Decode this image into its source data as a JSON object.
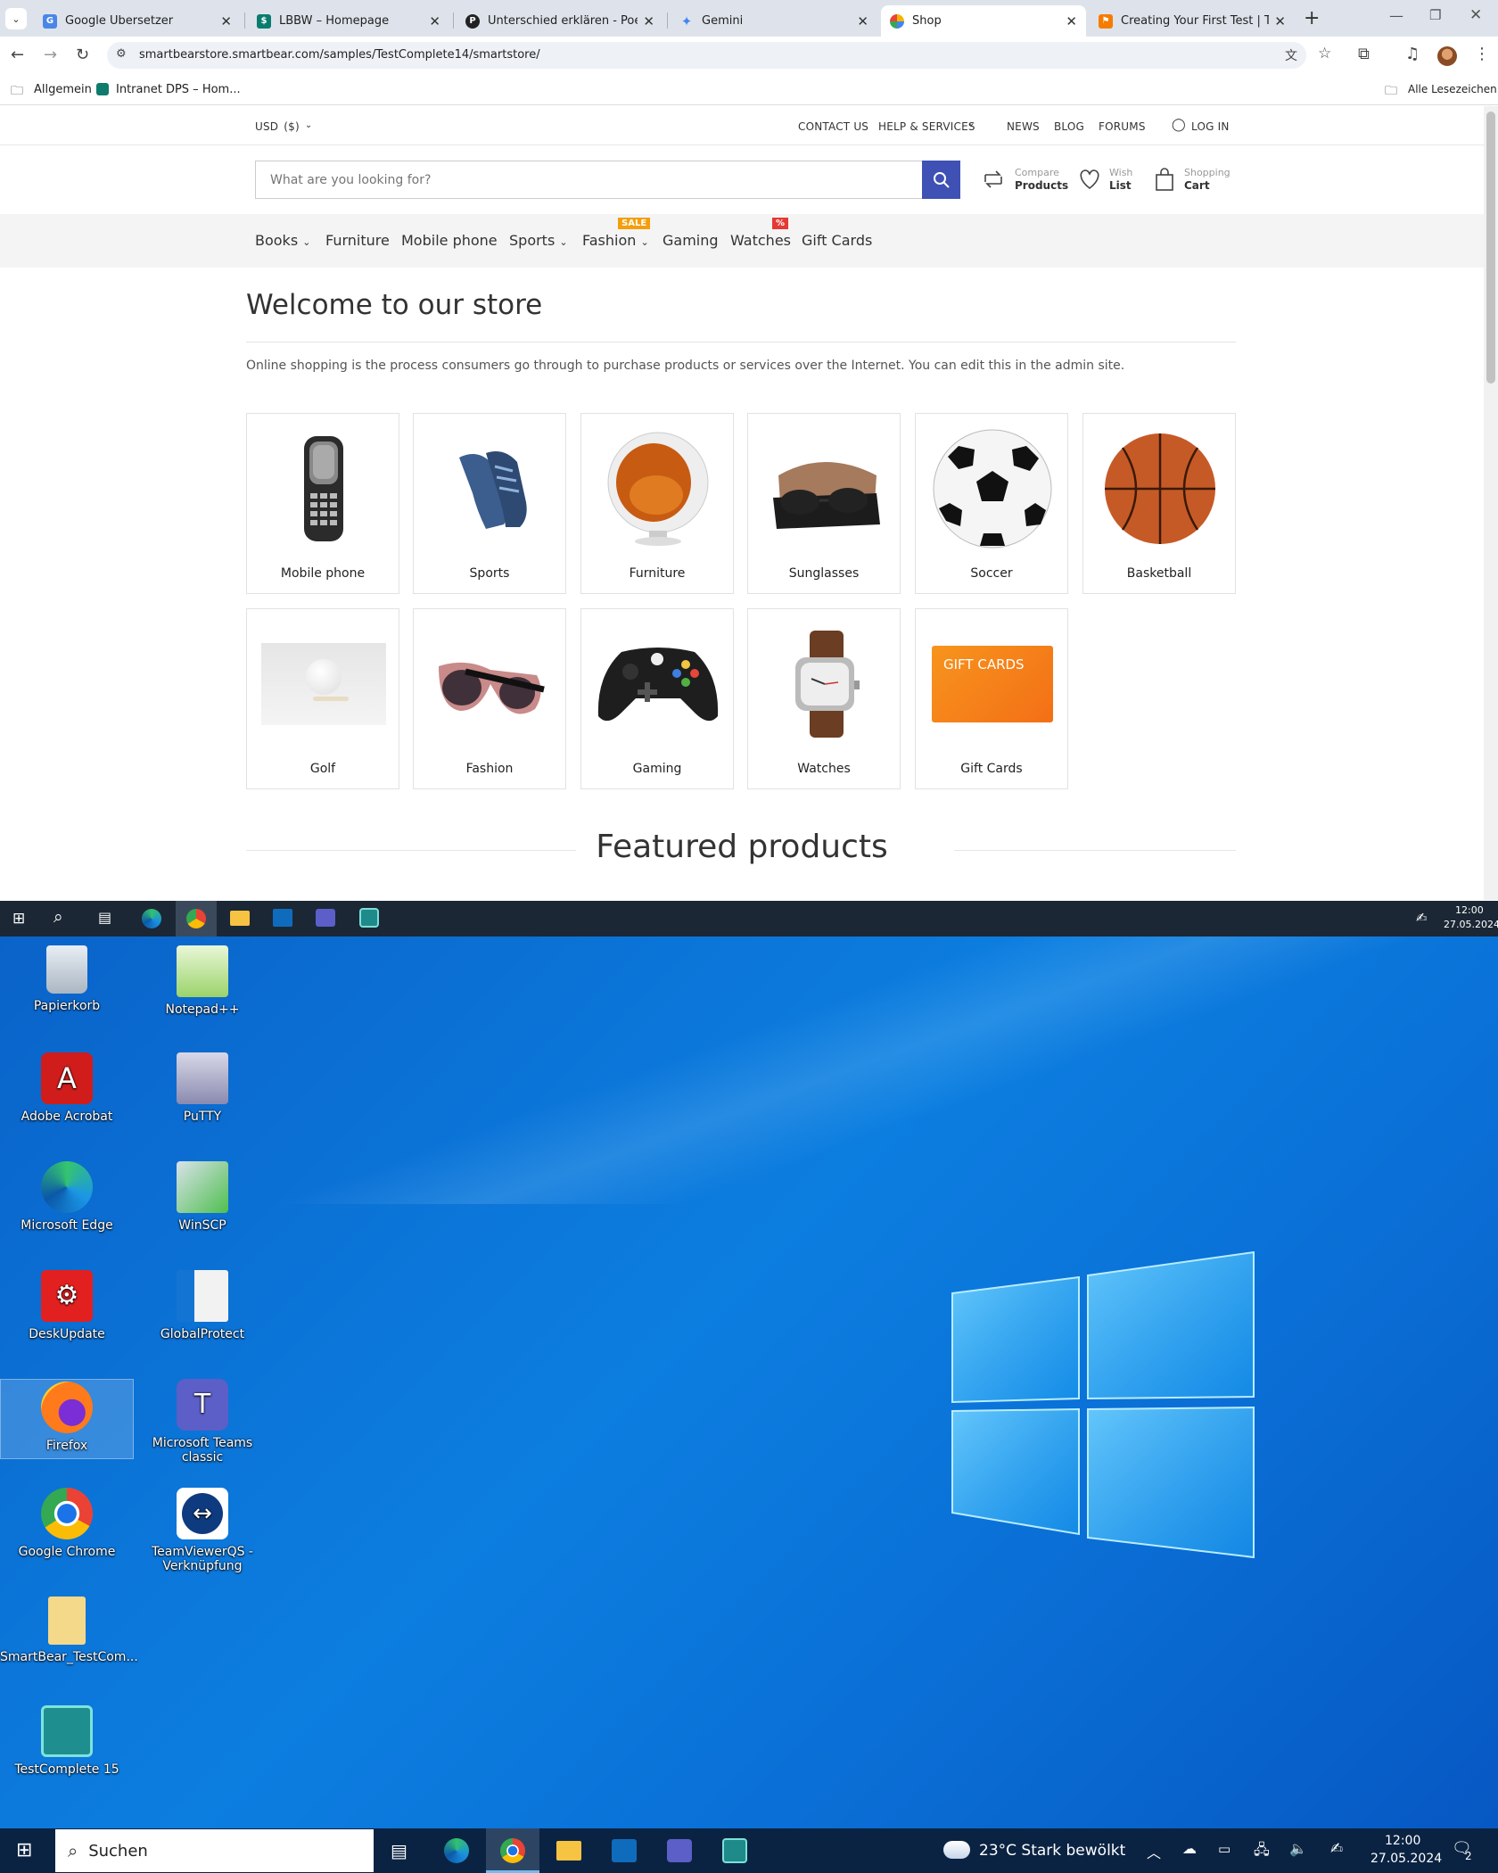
{
  "browser": {
    "tabs": [
      {
        "title": "Google Übersetzer",
        "active": false
      },
      {
        "title": "LBBW – Homepage",
        "active": false
      },
      {
        "title": "Unterschied erklären - Poe",
        "active": false
      },
      {
        "title": "Gemini",
        "active": false
      },
      {
        "title": "Shop",
        "active": true
      },
      {
        "title": "Creating Your First Test | TestCo",
        "active": false
      }
    ],
    "new_tab": "+",
    "url": "smartbearstore.smartbear.com/samples/TestComplete14/smartstore/",
    "bookmarks": [
      "Allgemein",
      "Intranet DPS – Hom..."
    ],
    "all_bookmarks": "Alle Lesezeichen"
  },
  "store": {
    "currency": "USD",
    "currency_symbol": "($)",
    "top_links": [
      "CONTACT US",
      "HELP & SERVICES",
      "NEWS",
      "BLOG",
      "FORUMS"
    ],
    "login": "LOG IN",
    "search_placeholder": "What are you looking for?",
    "compare": {
      "line1": "Compare",
      "line2": "Products"
    },
    "wishlist": {
      "line1": "Wish",
      "line2": "List"
    },
    "cart": {
      "line1": "Shopping",
      "line2": "Cart"
    },
    "nav": [
      "Books",
      "Furniture",
      "Mobile phone",
      "Sports",
      "Fashion",
      "Gaming",
      "Watches",
      "Gift Cards"
    ],
    "badge_sale": "SALE",
    "badge_percent": "%",
    "welcome_title": "Welcome to our store",
    "welcome_text": "Online shopping is the process consumers go through to purchase products or services over the Internet. You can edit this in the admin site.",
    "categories": [
      "Mobile phone",
      "Sports",
      "Furniture",
      "Sunglasses",
      "Soccer",
      "Basketball",
      "Golf",
      "Fashion",
      "Gaming",
      "Watches",
      "Gift Cards"
    ],
    "giftcard_text": "GIFT CARDS",
    "featured_title": "Featured products"
  },
  "taskbar_small": {
    "time": "12:00",
    "date": "27.05.2024"
  },
  "desktop_icons": [
    "Papierkorb",
    "Notepad++",
    "Adobe Acrobat",
    "PuTTY",
    "Microsoft Edge",
    "WinSCP",
    "DeskUpdate",
    "GlobalProtect",
    "Firefox",
    "Microsoft Teams classic",
    "Google Chrome",
    "TeamViewerQS - Verknüpfung",
    "SmartBear_TestCom...",
    "TestComplete 15"
  ],
  "taskbar": {
    "search_placeholder": "Suchen",
    "weather": "23°C  Stark bewölkt",
    "time": "12:00",
    "date": "27.05.2024",
    "notification_count": "2"
  },
  "colors": {
    "accent": "#3f51b5",
    "sale_badge": "#f59e0b",
    "percent_badge": "#e53935",
    "tab_bg": "#dee3eb"
  }
}
